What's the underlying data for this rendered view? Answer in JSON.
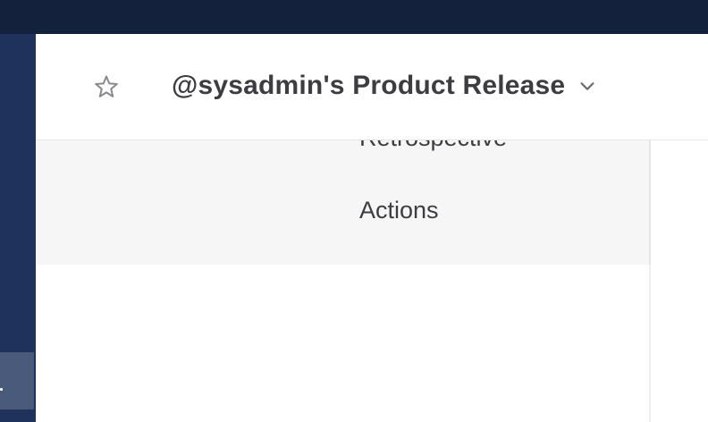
{
  "header": {
    "title": "@sysadmin's Product Release",
    "star_icon": "star-outline-icon",
    "dropdown_icon": "chevron-down-icon"
  },
  "menu": {
    "items": [
      {
        "label": "Retrospective"
      },
      {
        "label": "Actions"
      }
    ]
  },
  "colors": {
    "topbar": "#14213d",
    "sidebar": "#1e325c",
    "sidebar_active": "#4a5a7a",
    "title_text": "#3d3c40",
    "menu_background": "#f6f6f6"
  }
}
